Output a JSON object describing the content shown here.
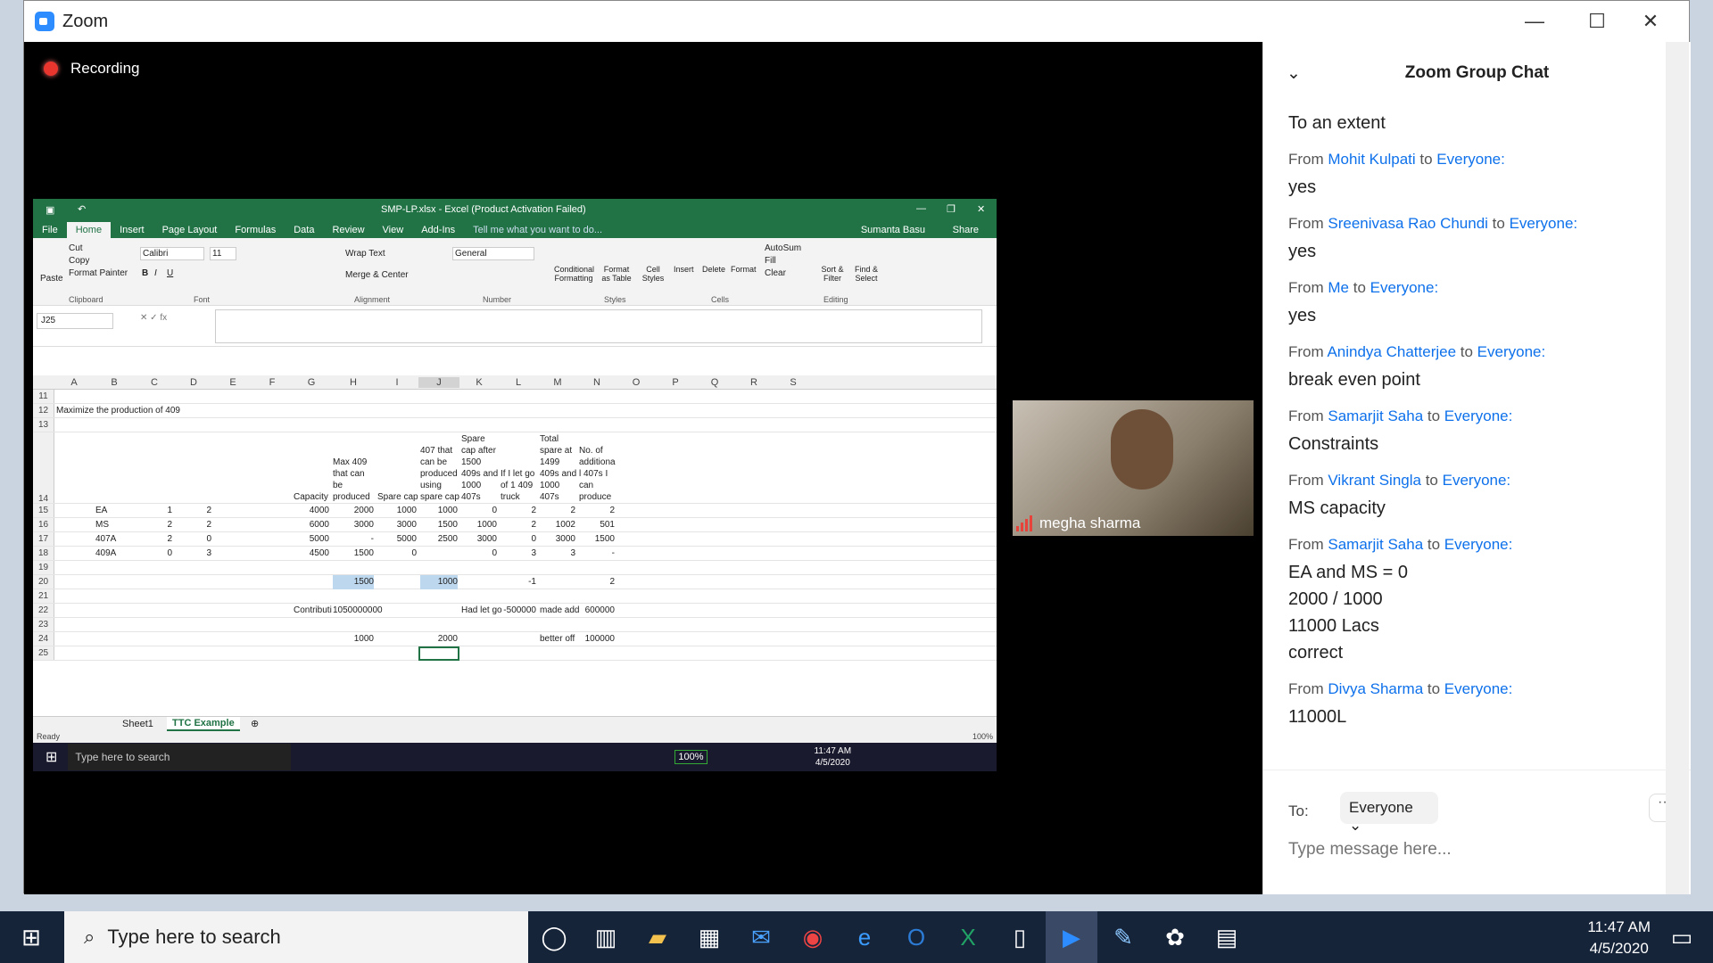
{
  "window": {
    "title": "Zoom"
  },
  "recording": {
    "label": "Recording"
  },
  "excel": {
    "title": "SMP-LP.xlsx - Excel (Product Activation Failed)",
    "user": "Sumanta Basu",
    "share": "Share",
    "tabs": [
      "File",
      "Home",
      "Insert",
      "Page Layout",
      "Formulas",
      "Data",
      "Review",
      "View",
      "Add-Ins"
    ],
    "tell_me": "Tell me what you want to do...",
    "ribbon": {
      "clipboard": "Clipboard",
      "font": "Font",
      "alignment": "Alignment",
      "number": "Number",
      "styles": "Styles",
      "cells": "Cells",
      "editing": "Editing",
      "paste": "Paste",
      "cut": "Cut",
      "copy": "Copy",
      "format_painter": "Format Painter",
      "font_name": "Calibri",
      "font_size": "11",
      "wrap_text": "Wrap Text",
      "merge_center": "Merge & Center",
      "number_format": "General",
      "autosum": "AutoSum",
      "fill": "Fill",
      "clear": "Clear",
      "cond_fmt": "Conditional Formatting",
      "format_table": "Format as Table",
      "cell_styles": "Cell Styles",
      "insert": "Insert",
      "delete": "Delete",
      "format": "Format",
      "sort_filter": "Sort & Filter",
      "find_select": "Find & Select"
    },
    "namebox": "J25",
    "columns": [
      "A",
      "B",
      "C",
      "D",
      "E",
      "F",
      "G",
      "H",
      "I",
      "J",
      "K",
      "L",
      "M",
      "N",
      "O",
      "P",
      "Q",
      "R",
      "S"
    ],
    "header_texts": {
      "G": "Capacity",
      "H": "Max 409 that can be produced",
      "I": "Spare cap",
      "J": "407 that can be produced using spare cap",
      "K": "Spare cap after 1500 409s and 1000 407s",
      "L": "If I let go of 1 409 truck",
      "M": "Total spare at 1499 409s and 1000 407s",
      "N": "No. of additiona l 407s I can produce"
    },
    "rows": [
      {
        "n": "11",
        "cells": {}
      },
      {
        "n": "12",
        "cells": {
          "A": "Maximize the production of 409"
        }
      },
      {
        "n": "13",
        "cells": {}
      },
      {
        "n": "14",
        "cells": {}
      },
      {
        "n": "15",
        "cells": {
          "B": "EA",
          "C": "1",
          "D": "2",
          "G": "4000",
          "H": "2000",
          "I": "1000",
          "J": "1000",
          "K": "0",
          "L": "2",
          "M": "2",
          "N": "2"
        }
      },
      {
        "n": "16",
        "cells": {
          "B": "MS",
          "C": "2",
          "D": "2",
          "G": "6000",
          "H": "3000",
          "I": "3000",
          "J": "1500",
          "K": "1000",
          "L": "2",
          "M": "1002",
          "N": "501"
        }
      },
      {
        "n": "17",
        "cells": {
          "B": "407A",
          "C": "2",
          "D": "0",
          "G": "5000",
          "H": "-",
          "I": "5000",
          "J": "2500",
          "K": "3000",
          "L": "0",
          "M": "3000",
          "N": "1500"
        }
      },
      {
        "n": "18",
        "cells": {
          "B": "409A",
          "C": "0",
          "D": "3",
          "G": "4500",
          "H": "1500",
          "I": "0",
          "K": "0",
          "L": "3",
          "M": "3",
          "N": "-"
        }
      },
      {
        "n": "19",
        "cells": {}
      },
      {
        "n": "20",
        "cells": {
          "H": "1500",
          "J": "1000",
          "L": "-1",
          "N": "2"
        }
      },
      {
        "n": "21",
        "cells": {}
      },
      {
        "n": "22",
        "cells": {
          "G": "Contributi",
          "H": "1050000000",
          "K": "Had let go",
          "L": "-500000",
          "M": "made add",
          "N": "600000"
        }
      },
      {
        "n": "23",
        "cells": {}
      },
      {
        "n": "24",
        "cells": {
          "H": "1000",
          "J": "2000",
          "M": "better off",
          "N": "100000"
        }
      },
      {
        "n": "25",
        "cells": {}
      }
    ],
    "sheets": [
      "Sheet1",
      "TTC Example"
    ],
    "status": "Ready",
    "zoom": "100%"
  },
  "inner_taskbar": {
    "search": "Type here to search",
    "time": "11:47 AM",
    "date": "4/5/2020",
    "battery": "100%"
  },
  "video": {
    "name": "megha sharma"
  },
  "chat": {
    "title": "Zoom Group Chat",
    "to_label": "To:",
    "recipient": "Everyone",
    "placeholder": "Type message here...",
    "more": "···",
    "first_text": "To an extent",
    "messages": [
      {
        "from": "Mohit Kulpati",
        "to": "Everyone:",
        "lines": [
          "yes"
        ]
      },
      {
        "from": "Sreenivasa Rao Chundi",
        "to": "Everyone:",
        "lines": [
          "yes"
        ]
      },
      {
        "from": "Me",
        "to": "Everyone:",
        "lines": [
          "yes"
        ]
      },
      {
        "from": "Anindya Chatterjee",
        "to": "Everyone:",
        "lines": [
          "break even point"
        ]
      },
      {
        "from": "Samarjit Saha",
        "to": "Everyone:",
        "lines": [
          "Constraints"
        ]
      },
      {
        "from": "Vikrant Singla",
        "to": "Everyone:",
        "lines": [
          "MS capacity"
        ]
      },
      {
        "from": "Samarjit Saha",
        "to": "Everyone:",
        "lines": [
          "EA and MS = 0",
          "2000 / 1000",
          "11000 Lacs",
          "correct"
        ]
      },
      {
        "from": "Divya Sharma",
        "to": "Everyone:",
        "lines": [
          "11000L"
        ]
      }
    ],
    "from_word": "From",
    "to_word": "to"
  },
  "taskbar": {
    "search": "Type here to search",
    "time": "11:47 AM",
    "date": "4/5/2020"
  }
}
